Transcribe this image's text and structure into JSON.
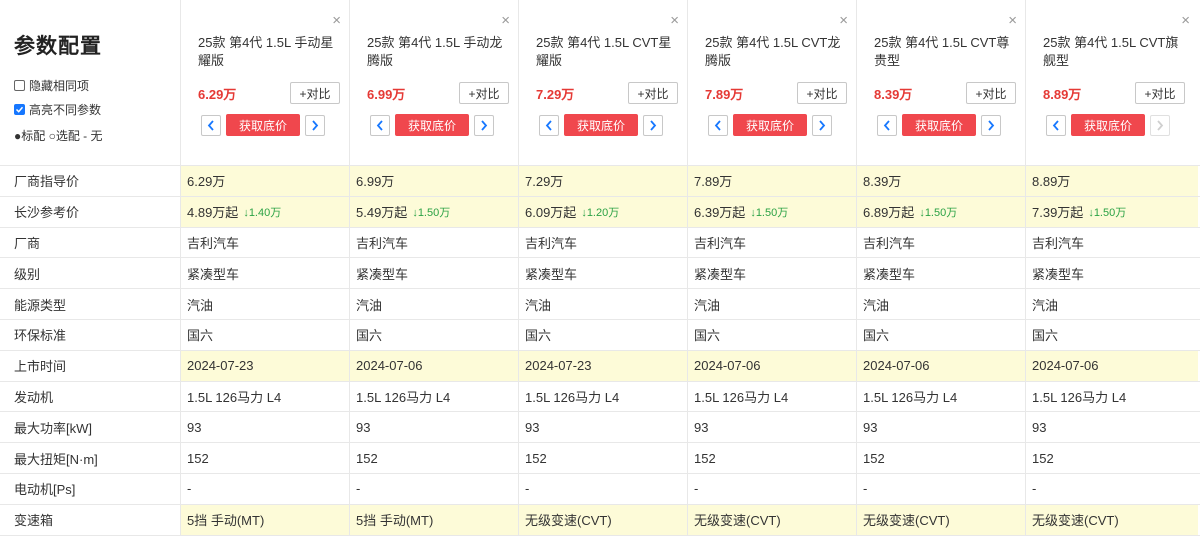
{
  "page_title": "参数配置",
  "options": {
    "hide_same": "隐藏相同项",
    "highlight_diff": "高亮不同参数",
    "legend": "●标配 ○选配 - 无"
  },
  "compare_label": "+对比",
  "quote_label": "获取底价",
  "cars": [
    {
      "name": "25款 第4代 1.5L 手动星耀版",
      "price": "6.29万"
    },
    {
      "name": "25款 第4代 1.5L 手动龙腾版",
      "price": "6.99万"
    },
    {
      "name": "25款 第4代 1.5L CVT星耀版",
      "price": "7.29万"
    },
    {
      "name": "25款 第4代 1.5L CVT龙腾版",
      "price": "7.89万"
    },
    {
      "name": "25款 第4代 1.5L CVT尊贵型",
      "price": "8.39万"
    },
    {
      "name": "25款 第4代 1.5L CVT旗舰型",
      "price": "8.89万"
    }
  ],
  "rows": [
    {
      "label": "厂商指导价",
      "hl": true,
      "values": [
        "6.29万",
        "6.99万",
        "7.29万",
        "7.89万",
        "8.39万",
        "8.89万"
      ]
    },
    {
      "label": "长沙参考价",
      "hl": true,
      "values": [
        "4.89万起",
        "5.49万起",
        "6.09万起",
        "6.39万起",
        "6.89万起",
        "7.39万起"
      ],
      "drops": [
        "↓1.40万",
        "↓1.50万",
        "↓1.20万",
        "↓1.50万",
        "↓1.50万",
        "↓1.50万"
      ]
    },
    {
      "label": "厂商",
      "hl": false,
      "values": [
        "吉利汽车",
        "吉利汽车",
        "吉利汽车",
        "吉利汽车",
        "吉利汽车",
        "吉利汽车"
      ]
    },
    {
      "label": "级别",
      "hl": false,
      "values": [
        "紧凑型车",
        "紧凑型车",
        "紧凑型车",
        "紧凑型车",
        "紧凑型车",
        "紧凑型车"
      ]
    },
    {
      "label": "能源类型",
      "hl": false,
      "values": [
        "汽油",
        "汽油",
        "汽油",
        "汽油",
        "汽油",
        "汽油"
      ]
    },
    {
      "label": "环保标准",
      "hl": false,
      "values": [
        "国六",
        "国六",
        "国六",
        "国六",
        "国六",
        "国六"
      ]
    },
    {
      "label": "上市时间",
      "hl": true,
      "values": [
        "2024-07-23",
        "2024-07-06",
        "2024-07-23",
        "2024-07-06",
        "2024-07-06",
        "2024-07-06"
      ]
    },
    {
      "label": "发动机",
      "hl": false,
      "values": [
        "1.5L 126马力 L4",
        "1.5L 126马力 L4",
        "1.5L 126马力 L4",
        "1.5L 126马力 L4",
        "1.5L 126马力 L4",
        "1.5L 126马力 L4"
      ]
    },
    {
      "label": "最大功率[kW]",
      "hl": false,
      "values": [
        "93",
        "93",
        "93",
        "93",
        "93",
        "93"
      ]
    },
    {
      "label": "最大扭矩[N·m]",
      "hl": false,
      "values": [
        "152",
        "152",
        "152",
        "152",
        "152",
        "152"
      ]
    },
    {
      "label": "电动机[Ps]",
      "hl": false,
      "values": [
        "-",
        "-",
        "-",
        "-",
        "-",
        "-"
      ]
    },
    {
      "label": "变速箱",
      "hl": true,
      "values": [
        "5挡 手动(MT)",
        "5挡 手动(MT)",
        "无级变速(CVT)",
        "无级变速(CVT)",
        "无级变速(CVT)",
        "无级变速(CVT)"
      ]
    }
  ],
  "colors": {
    "price": "#e53935",
    "quote_button": "#f0474d",
    "highlight_row": "#fdfbd8",
    "drop_text": "#2ba245",
    "nav_arrow": "#1677ff"
  }
}
